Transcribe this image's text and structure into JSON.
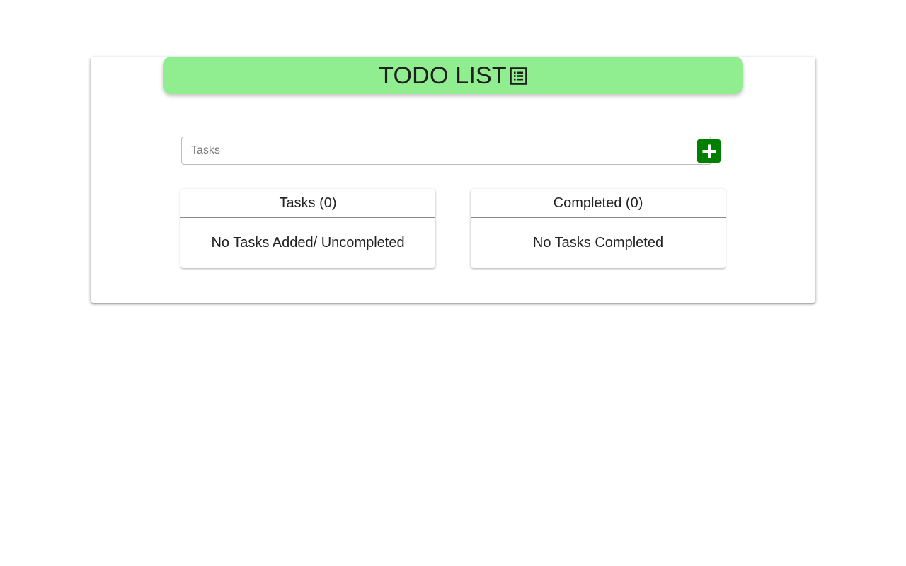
{
  "header": {
    "title": "TODO LIST",
    "icon": "list-icon",
    "background_color": "#90ee90"
  },
  "input": {
    "placeholder": "Tasks",
    "value": ""
  },
  "add_button": {
    "icon": "plus-icon",
    "color": "#008000"
  },
  "panels": {
    "tasks": {
      "title": "Tasks (0)",
      "empty_message": "No Tasks Added/ Uncompleted"
    },
    "completed": {
      "title": "Completed (0)",
      "empty_message": "No Tasks Completed"
    }
  }
}
